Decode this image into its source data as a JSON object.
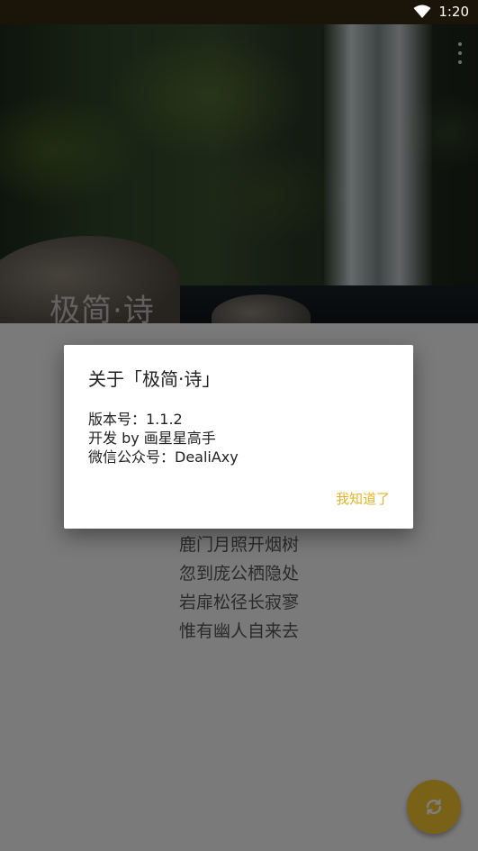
{
  "status_bar": {
    "time": "1:20"
  },
  "hero": {
    "title": "极简·诗"
  },
  "poem": {
    "lines": [
      "鹿门月照开烟树",
      "忽到庞公栖隐处",
      "岩扉松径长寂寥",
      "惟有幽人自来去"
    ]
  },
  "dialog": {
    "title": "关于「极简·诗」",
    "version": "版本号：1.1.2",
    "developer": "开发 by 画星星高手",
    "wechat": "微信公众号：DealiAxy",
    "action": "我知道了"
  },
  "colors": {
    "accent": "#f2c230",
    "action_text": "#e3b52a",
    "status_bar": "#1a1508"
  },
  "icons": {
    "wifi": "wifi-icon",
    "menu": "more-vert-icon",
    "refresh": "refresh-icon"
  }
}
